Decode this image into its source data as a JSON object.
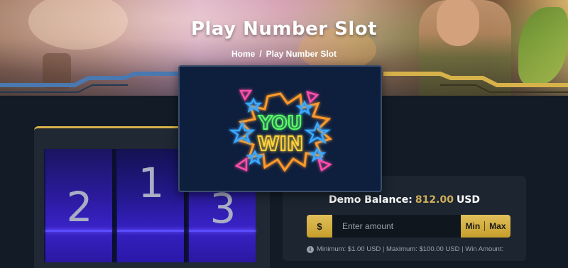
{
  "hero": {
    "title": "Play Number Slot",
    "breadcrumb": {
      "home": "Home",
      "separator": "/",
      "current": "Play Number Slot"
    }
  },
  "slot": {
    "reels": [
      {
        "number": "2"
      },
      {
        "number": "1"
      },
      {
        "number": "3"
      }
    ]
  },
  "popup": {
    "line1": "YOU",
    "line2": "WIN"
  },
  "balance": {
    "label": "Demo Balance:",
    "amount": "812.00",
    "currency": "USD"
  },
  "bet": {
    "currency_symbol": "$",
    "placeholder": "Enter amount",
    "min_label": "Min",
    "max_label": "Max"
  },
  "info": {
    "text": "Minimum: $1.00 USD | Maximum: $100.00 USD | Win Amount:"
  },
  "colors": {
    "accent_gold": "#d7b24a",
    "frame_blue": "#4a78b0",
    "background": "#131c26"
  }
}
